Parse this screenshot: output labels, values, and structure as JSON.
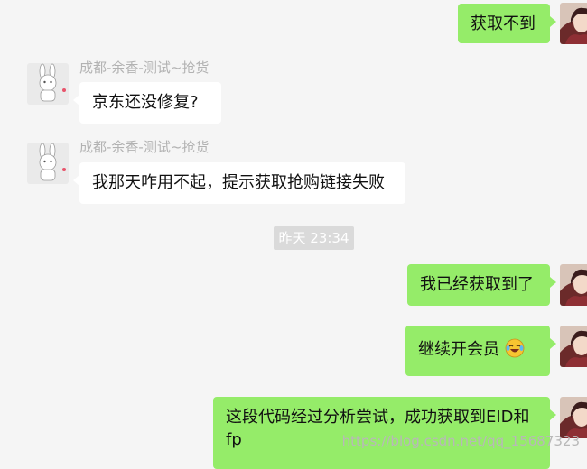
{
  "messages": [
    {
      "id": "m1",
      "direction": "out",
      "text": "获取不到"
    },
    {
      "id": "m2",
      "direction": "in",
      "sender": "成都-余香-测试~抢货",
      "text": "京东还没修复?"
    },
    {
      "id": "m3",
      "direction": "in",
      "sender": "成都-余香-测试~抢货",
      "text": "我那天咋用不起，提示获取抢购链接失败"
    },
    {
      "id": "m4",
      "direction": "out",
      "text": "我已经获取到了"
    },
    {
      "id": "m5",
      "direction": "out",
      "text": "继续开会员",
      "emoji": "laughing-tears-emoji"
    },
    {
      "id": "m6",
      "direction": "out",
      "text": "这段代码经过分析尝试，成功获取到EID和",
      "text_line2": "fp"
    }
  ],
  "timestamp": "昨天 23:34",
  "watermark": "https://blog.csdn.net/qq_15687323",
  "colors": {
    "outgoing_bubble": "#95ec69",
    "incoming_bubble": "#ffffff",
    "background": "#f5f5f5"
  }
}
